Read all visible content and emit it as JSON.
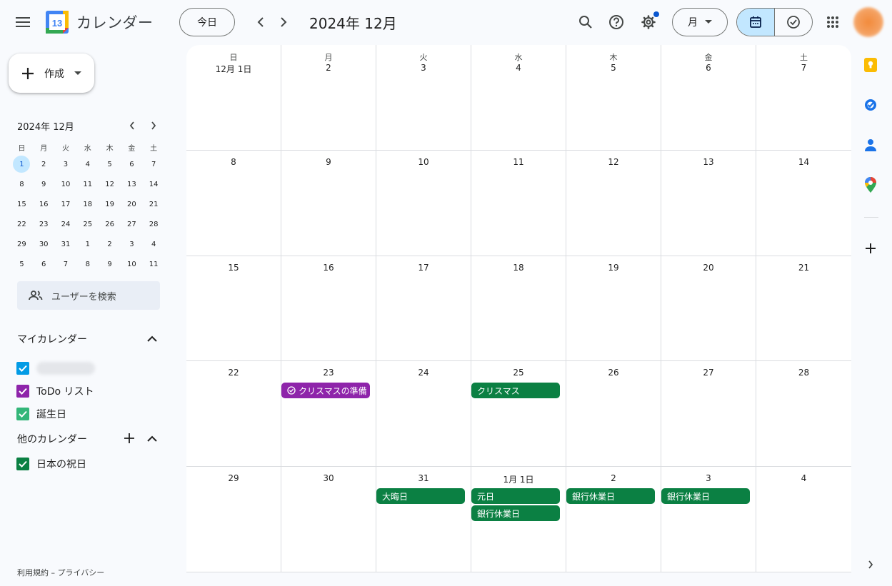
{
  "header": {
    "app_title": "カレンダー",
    "logo_number": "13",
    "today_label": "今日",
    "period_title": "2024年 12月",
    "view_label": "月"
  },
  "sidebar": {
    "create_label": "作成",
    "mini_calendar": {
      "title": "2024年 12月",
      "weekdays": [
        "日",
        "月",
        "火",
        "水",
        "木",
        "金",
        "土"
      ],
      "weeks": [
        [
          "1",
          "2",
          "3",
          "4",
          "5",
          "6",
          "7"
        ],
        [
          "8",
          "9",
          "10",
          "11",
          "12",
          "13",
          "14"
        ],
        [
          "15",
          "16",
          "17",
          "18",
          "19",
          "20",
          "21"
        ],
        [
          "22",
          "23",
          "24",
          "25",
          "26",
          "27",
          "28"
        ],
        [
          "29",
          "30",
          "31",
          "1",
          "2",
          "3",
          "4"
        ],
        [
          "5",
          "6",
          "7",
          "8",
          "9",
          "10",
          "11"
        ]
      ],
      "today": "1"
    },
    "user_search_placeholder": "ユーザーを検索",
    "my_calendars_title": "マイカレンダー",
    "my_calendars": [
      {
        "label": "",
        "color": "#039be5",
        "blurred": true
      },
      {
        "label": "ToDo リスト",
        "color": "#8e24aa"
      },
      {
        "label": "誕生日",
        "color": "#33b679"
      }
    ],
    "other_calendars_title": "他のカレンダー",
    "other_calendars": [
      {
        "label": "日本の祝日",
        "color": "#0b8043"
      }
    ],
    "footer": "利用規約 – プライバシー"
  },
  "calendar": {
    "weekdays": [
      "日",
      "月",
      "火",
      "水",
      "木",
      "金",
      "土"
    ],
    "weeks": [
      [
        "12月 1日",
        "2",
        "3",
        "4",
        "5",
        "6",
        "7"
      ],
      [
        "8",
        "9",
        "10",
        "11",
        "12",
        "13",
        "14"
      ],
      [
        "15",
        "16",
        "17",
        "18",
        "19",
        "20",
        "21"
      ],
      [
        "22",
        "23",
        "24",
        "25",
        "26",
        "27",
        "28"
      ],
      [
        "29",
        "30",
        "31",
        "1月 1日",
        "2",
        "3",
        "4"
      ]
    ],
    "events": [
      {
        "week": 3,
        "day": 1,
        "title": "クリスマスの準備",
        "color": "#8e24aa",
        "task": true
      },
      {
        "week": 3,
        "day": 3,
        "title": "クリスマス",
        "color": "#0b8043"
      },
      {
        "week": 4,
        "day": 2,
        "title": "大晦日",
        "color": "#0b8043"
      },
      {
        "week": 4,
        "day": 3,
        "title": "元日",
        "color": "#0b8043"
      },
      {
        "week": 4,
        "day": 3,
        "title": "銀行休業日",
        "color": "#0b8043"
      },
      {
        "week": 4,
        "day": 4,
        "title": "銀行休業日",
        "color": "#0b8043"
      },
      {
        "week": 4,
        "day": 5,
        "title": "銀行休業日",
        "color": "#0b8043"
      }
    ]
  },
  "side_panel": {
    "apps": [
      {
        "name": "keep-icon",
        "color": "#fbbc04"
      },
      {
        "name": "tasks-icon",
        "color": "#1a73e8"
      },
      {
        "name": "contacts-icon",
        "color": "#1a73e8"
      },
      {
        "name": "maps-icon",
        "color": "#34a853"
      }
    ]
  }
}
